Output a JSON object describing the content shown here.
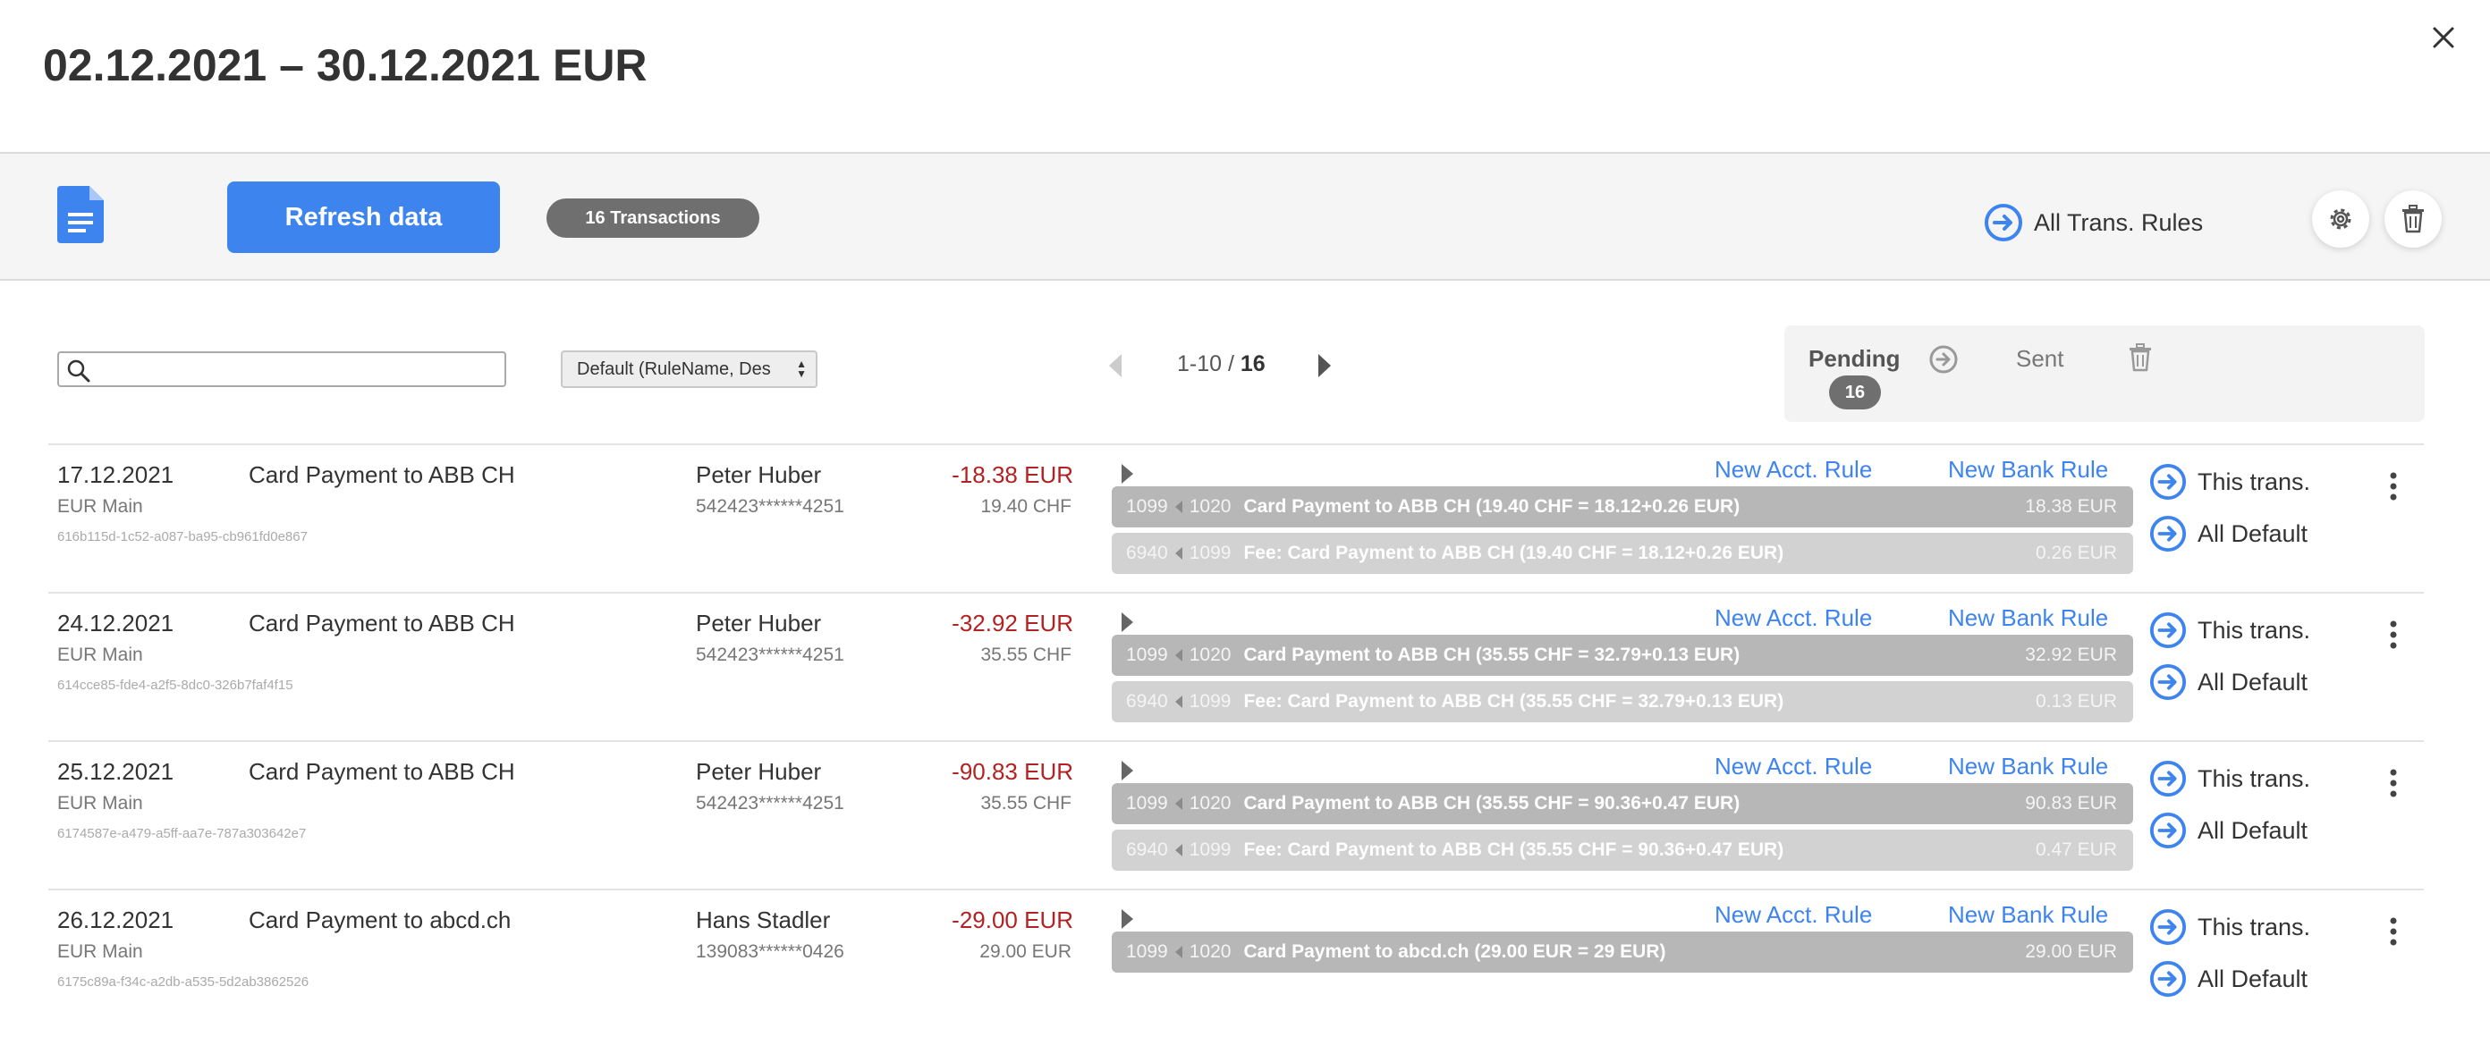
{
  "header": {
    "title": "02.12.2021 – 30.12.2021 EUR"
  },
  "toolbar": {
    "refresh_label": "Refresh data",
    "transactions_badge": "16 Transactions",
    "all_rules_label": "All Trans. Rules"
  },
  "filters": {
    "search_value": "",
    "sort_selected": "Default (RuleName, Des"
  },
  "pager": {
    "range": "1-10 / ",
    "total": "16"
  },
  "status": {
    "pending_label": "Pending",
    "pending_count": "16",
    "sent_label": "Sent"
  },
  "colors": {
    "accent": "#3d84ef",
    "negative_amount": "#b22222",
    "booking_main": "#b7b7b7",
    "booking_fee": "#d2d2d2"
  },
  "rows": [
    {
      "date": "17.12.2021",
      "description": "Card Payment to ABB CH",
      "account": "EUR Main",
      "uuid": "616b115d-1c52-a087-ba95-cb961fd0e867",
      "party": "Peter Huber",
      "card": "542423******4251",
      "amount": "-18.38 EUR",
      "amount_orig": "19.40 CHF",
      "new_acct_rule": "New Acct. Rule",
      "new_bank_rule": "New Bank Rule",
      "bookings": [
        {
          "acc1": "1099",
          "acc2": "1020",
          "text": "Card Payment to ABB CH (19.40 CHF = 18.12+0.26 EUR)",
          "amount": "18.38 EUR"
        },
        {
          "acc1": "6940",
          "acc2": "1099",
          "text": "Fee: Card Payment to ABB CH (19.40 CHF = 18.12+0.26 EUR)",
          "amount": "0.26 EUR"
        }
      ],
      "this_trans": "This trans.",
      "all_default": "All Default"
    },
    {
      "date": "24.12.2021",
      "description": "Card Payment to ABB CH",
      "account": "EUR Main",
      "uuid": "614cce85-fde4-a2f5-8dc0-326b7faf4f15",
      "party": "Peter Huber",
      "card": "542423******4251",
      "amount": "-32.92 EUR",
      "amount_orig": "35.55 CHF",
      "new_acct_rule": "New Acct. Rule",
      "new_bank_rule": "New Bank Rule",
      "bookings": [
        {
          "acc1": "1099",
          "acc2": "1020",
          "text": "Card Payment to ABB CH (35.55 CHF = 32.79+0.13 EUR)",
          "amount": "32.92 EUR"
        },
        {
          "acc1": "6940",
          "acc2": "1099",
          "text": "Fee: Card Payment to ABB CH (35.55 CHF = 32.79+0.13 EUR)",
          "amount": "0.13 EUR"
        }
      ],
      "this_trans": "This trans.",
      "all_default": "All Default"
    },
    {
      "date": "25.12.2021",
      "description": "Card Payment to ABB CH",
      "account": "EUR Main",
      "uuid": "6174587e-a479-a5ff-aa7e-787a303642e7",
      "party": "Peter Huber",
      "card": "542423******4251",
      "amount": "-90.83 EUR",
      "amount_orig": "35.55 CHF",
      "new_acct_rule": "New Acct. Rule",
      "new_bank_rule": "New Bank Rule",
      "bookings": [
        {
          "acc1": "1099",
          "acc2": "1020",
          "text": "Card Payment to ABB CH (35.55 CHF = 90.36+0.47 EUR)",
          "amount": "90.83 EUR"
        },
        {
          "acc1": "6940",
          "acc2": "1099",
          "text": "Fee: Card Payment to ABB CH (35.55 CHF = 90.36+0.47 EUR)",
          "amount": "0.47 EUR"
        }
      ],
      "this_trans": "This trans.",
      "all_default": "All Default"
    },
    {
      "date": "26.12.2021",
      "description": "Card Payment to abcd.ch",
      "account": "EUR Main",
      "uuid": "6175c89a-f34c-a2db-a535-5d2ab3862526",
      "party": "Hans Stadler",
      "card": "139083******0426",
      "amount": "-29.00 EUR",
      "amount_orig": "29.00 EUR",
      "new_acct_rule": "New Acct. Rule",
      "new_bank_rule": "New Bank Rule",
      "bookings": [
        {
          "acc1": "1099",
          "acc2": "1020",
          "text": "Card Payment to abcd.ch (29.00 EUR = 29 EUR)",
          "amount": "29.00 EUR"
        }
      ],
      "this_trans": "This trans.",
      "all_default": "All Default"
    }
  ]
}
